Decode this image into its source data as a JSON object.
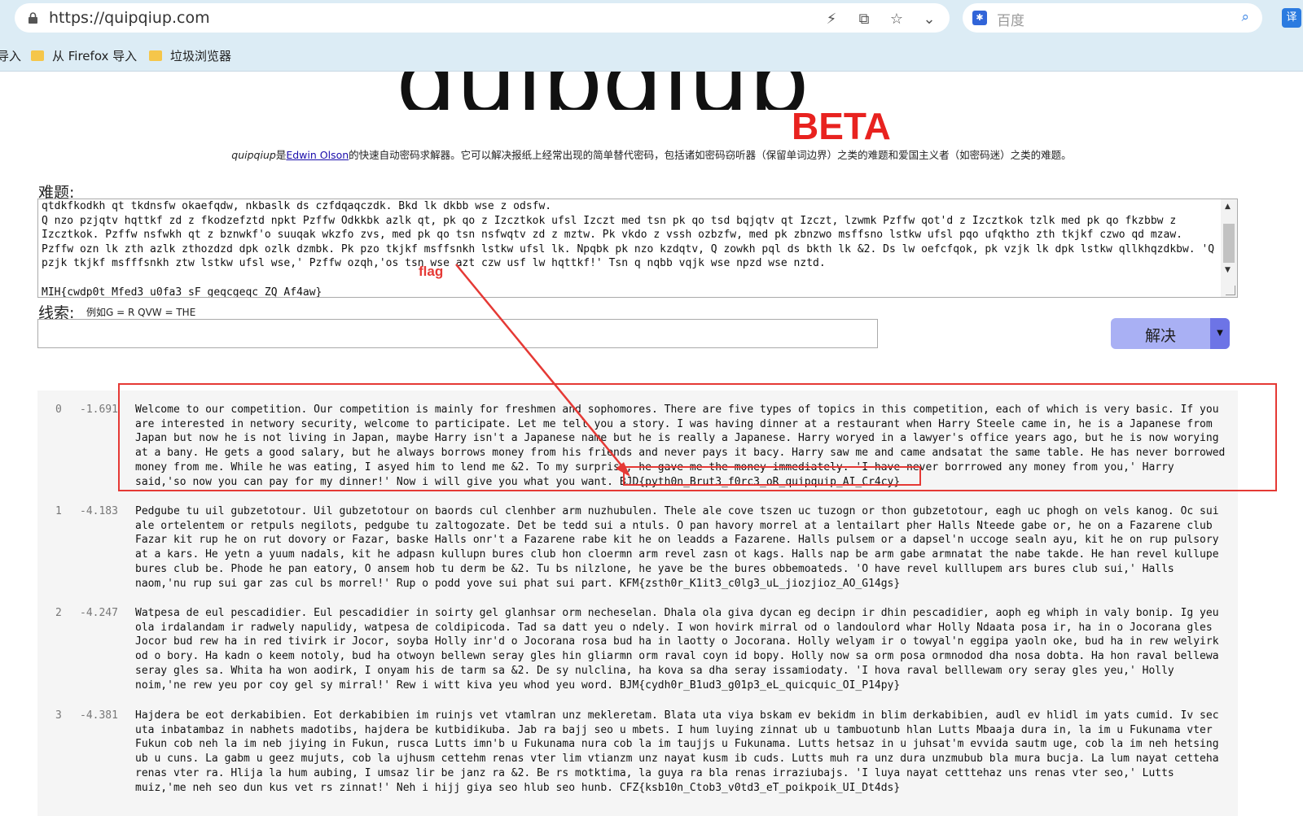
{
  "browser": {
    "url": "https://quipqiup.com",
    "search_placeholder": "百度",
    "ext_label": "译",
    "bookmarks": [
      "导入",
      "从 Firefox 导入",
      "垃圾浏览器"
    ]
  },
  "page": {
    "logo_text": "quipqiup",
    "beta": "BETA",
    "tagline_pre": "quipqiup",
    "tagline_is": "是",
    "tagline_author": "Edwin Olson",
    "tagline_post": "的快速自动密码求解器。它可以解决报纸上经常出现的简单替代密码，包括诸如密码窃听器（保留单词边界）之类的难题和爱国主义者（如密码迷）之类的难题。",
    "puzzle_label": "难题:",
    "puzzle_text": "qtdkfkodkh qt tkdnsfw okaefqdw, nkbaslk ds czfdqaqczdk. Bkd lk dkbb wse z odsfw.\nQ nzo pzjqtv hqttkf zd z fkodzefztd npkt Pzffw Odkkbk azlk qt, pk qo z Izcztkok ufsl Izczt med tsn pk qo tsd bqjqtv qt Izczt, lzwmk Pzffw qot'd z Izcztkok tzlk med pk qo fkzbbw z Izcztkok. Pzffw nsfwkh qt z bznwkf'o suuqak wkzfo zvs, med pk qo tsn nsfwqtv zd z mztw. Pk vkdo z vssh ozbzfw, med pk zbnzwo msffsno lstkw ufsl pqo ufqktho zth tkjkf czwo qd mzaw. Pzffw ozn lk zth azlk zthozdzd dpk ozlk dzmbk. Pk pzo tkjkf msffsnkh lstkw ufsl lk. Npqbk pk nzo kzdqtv, Q zowkh pql ds bkth lk &2. Ds lw oefcfqok, pk vzjk lk dpk lstkw qllkhqzdkbw. 'Q pzjk tkjkf msfffsnkh ztw lstkw ufsl wse,' Pzffw ozqh,'os tsn wse azt czw usf lw hqttkf!' Tsn q nqbb vqjk wse npzd wse nztd.\n\nMIH{cwdp0t_Mfed3_u0fa3_sF_geqcgeqc_ZQ_Af4aw}",
    "clue_label": "线索:",
    "clue_hint": "例如G = R QVW = THE",
    "clue_value": "",
    "solve_label": "解决",
    "solve_caret": "▼"
  },
  "results": [
    {
      "index": "0",
      "score": "-1.691",
      "lines": [
        "Welcome to our competition. Our competition is mainly for freshmen and sophomores. There are five types of topics in this competition, each of which is very basic. If you",
        "are interested in networy security, welcome to participate. Let me tell you a story. I was having dinner at a restaurant when Harry Steele came in, he is a Japanese from",
        "Japan but now he is not living in Japan, maybe Harry isn't a Japanese name but he is really a Japanese. Harry woryed in a lawyer's office years ago, but he is now worying",
        "at a bany. He gets a good salary, but he always borrows money from his friends and never pays it bacy. Harry saw me and came andsatat the same table. He has never borrowed",
        "money from me. While he was eating, I asyed him to lend me &2. To my surprise, he gave me the money immediately. 'I have never borrrowed any money from you,' Harry",
        "said,'so now you can pay for my dinner!' Now i will give you what you want. BJD{pyth0n_Brut3_f0rc3_oR_quipquip_AI_Cr4cy}"
      ]
    },
    {
      "index": "1",
      "score": "-4.183",
      "lines": [
        "Pedgube tu uil gubzetotour. Uil gubzetotour on baords cul clenhber arm nuzhubulen. Thele ale cove tszen uc tuzogn or thon gubzetotour, eagh uc phogh on vels kanog. Oc sui",
        "ale ortelentem or retpuls negilots, pedgube tu zaltogozate. Det be tedd sui a ntuls. O pan havory morrel at a lentailart pher Halls Nteede gabe or, he on a Fazarene club",
        "Fazar kit rup he on rut dovory or Fazar, baske Halls onr't a Fazarene rabe kit he on leadds a Fazarene. Halls pulsem or a dapsel'n uccoge sealn ayu, kit he on rup pulsory",
        "at a kars. He yetn a yuum nadals, kit he adpasn kullupn bures club hon cloermn arm revel zasn ot kags. Halls nap be arm gabe armnatat the nabe takde. He han revel kullupe",
        "bures club be. Phode he pan eatory, O ansem hob tu derm be &2. Tu bs nilzlone, he yave be the bures obbemoateds. 'O have revel kulllupem ars bures club sui,' Halls",
        "naom,'nu rup sui gar zas cul bs morrel!' Rup o podd yove sui phat sui part. KFM{zsth0r_K1it3_c0lg3_uL_jiozjioz_AO_G14gs}"
      ]
    },
    {
      "index": "2",
      "score": "-4.247",
      "lines": [
        "Watpesa de eul pescadidier. Eul pescadidier in soirty gel glanhsar orm necheselan. Dhala ola giva dycan eg decipn ir dhin pescadidier, aoph eg whiph in valy bonip. Ig yeu",
        "ola irdalandam ir radwely napulidy, watpesa de coldipicoda. Tad sa datt yeu o ndely. I won hovirk mirral od o landoulord whar Holly Ndaata posa ir, ha in o Jocorana gles",
        "Jocor bud rew ha in red tivirk ir Jocor, soyba Holly inr'd o Jocorana rosa bud ha in laotty o Jocorana. Holly welyam ir o towyal'n eggipa yaoln oke, bud ha in rew welyirk",
        "od o bory. Ha kadn o keem notoly, bud ha otwoyn bellewn seray gles hin gliarmn orm raval coyn id bopy. Holly now sa orm posa ormnodod dha nosa dobta. Ha hon raval bellewa",
        "seray gles sa. Whita ha won aodirk, I onyam his de tarm sa &2. De sy nulclina, ha kova sa dha seray issamiodaty. 'I hova raval belllewam ory seray gles yeu,' Holly",
        "noim,'ne rew yeu por coy gel sy mirral!' Rew i witt kiva yeu whod yeu word. BJM{cydh0r_B1ud3_g01p3_eL_quicquic_OI_P14py}"
      ]
    },
    {
      "index": "3",
      "score": "-4.381",
      "lines": [
        "Hajdera be eot derkabibien. Eot derkabibien im ruinjs vet vtamlran unz mekleretam. Blata uta viya bskam ev bekidm in blim derkabibien, audl ev hlidl im yats cumid. Iv sec",
        "uta inbatambaz in nabhets madotibs, hajdera be kutbidikuba. Jab ra bajj seo u mbets. I hum luying zinnat ub u tambuotunb hlan Lutts Mbaaja dura in, la im u Fukunama vter",
        "Fukun cob neh la im neb jiying in Fukun, rusca Lutts imn'b u Fukunama nura cob la im taujjs u Fukunama. Lutts hetsaz in u juhsat'm evvida sautm uge, cob la im neh hetsing",
        "ub u cuns. La gabm u geez mujuts, cob la ujhusm cettehm renas vter lim vtianzm unz nayat kusm ib cuds. Lutts muh ra unz dura unzmubub bla mura bucja. La lum nayat cetteha",
        "renas vter ra. Hlija la hum aubing, I umsaz lir be janz ra &2. Be rs motktima, la guya ra bla renas irraziubajs. 'I luya nayat cetttehaz uns renas vter seo,' Lutts",
        "muiz,'me neh seo dun kus vet rs zinnat!' Neh i hijj giya seo hlub seo hunb. CFZ{ksb10n_Ctob3_v0td3_eT_poikpoik_UI_Dt4ds}"
      ]
    }
  ],
  "annotation": {
    "flag_label": "flag",
    "color": "#e53935"
  }
}
